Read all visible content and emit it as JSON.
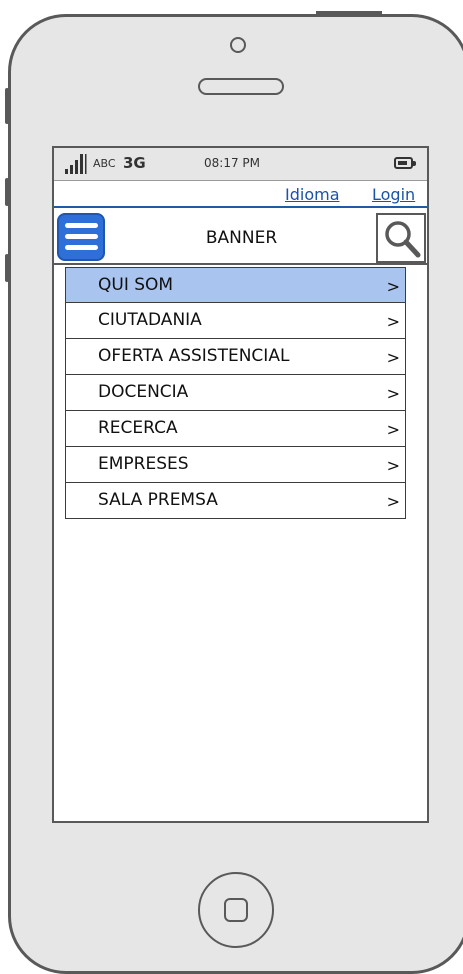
{
  "status_bar": {
    "carrier": "ABC",
    "network": "3G",
    "time": "08:17 PM"
  },
  "top_links": {
    "language": "Idioma",
    "login": "Login"
  },
  "header": {
    "banner": "BANNER"
  },
  "menu": {
    "items": [
      {
        "label": "QUI SOM",
        "arrow": ">"
      },
      {
        "label": "CIUTADANIA",
        "arrow": ">"
      },
      {
        "label": "OFERTA ASSISTENCIAL",
        "arrow": ">"
      },
      {
        "label": "DOCENCIA",
        "arrow": ">"
      },
      {
        "label": "RECERCA",
        "arrow": ">"
      },
      {
        "label": "EMPRESES",
        "arrow": ">"
      },
      {
        "label": "SALA PREMSA",
        "arrow": ">"
      }
    ],
    "selected_color": "#a9c4ee"
  },
  "colors": {
    "menu_button": "#2f6fd8",
    "link": "#1a53a8"
  },
  "icons": {
    "menu": "hamburger-icon",
    "search": "search-icon",
    "signal": "signal-icon",
    "battery": "battery-icon"
  }
}
